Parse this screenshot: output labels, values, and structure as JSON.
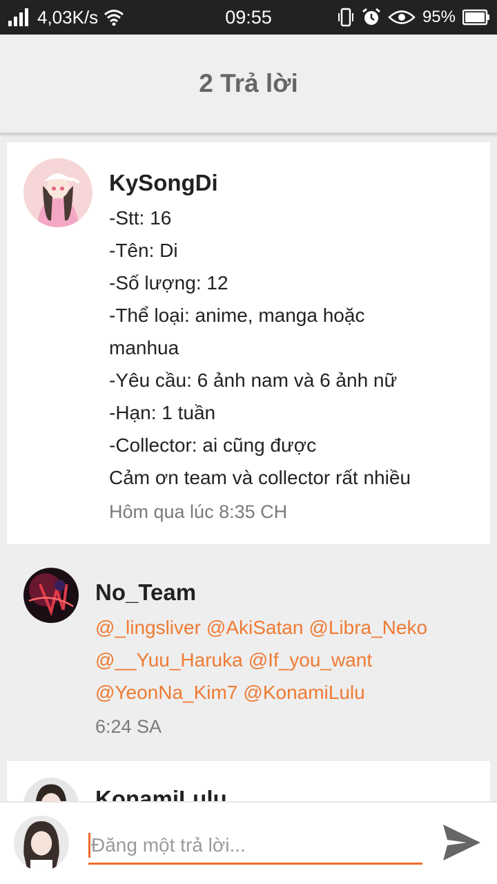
{
  "status_bar": {
    "network_speed": "4,03K/s",
    "time": "09:55",
    "battery": "95%"
  },
  "header": {
    "title": "2 Trả lời"
  },
  "comments": [
    {
      "username": "KySongDi",
      "lines": [
        "-Stt: 16",
        "-Tên: Di",
        "-Số lượng: 12",
        "-Thể loại: anime, manga hoặc",
        "manhua",
        "-Yêu cầu: 6 ảnh nam và 6 ảnh nữ",
        "-Hạn: 1 tuần",
        "-Collector: ai cũng được",
        "Cảm ơn team và collector rất nhiều"
      ],
      "timestamp": "Hôm qua lúc 8:35 CH"
    },
    {
      "username": "No_Team",
      "mentions": [
        "@_lingsliver",
        "@AkiSatan",
        "@Libra_Neko",
        "@__Yuu_Haruka",
        "@If_you_want",
        "@YeonNa_Kim7",
        "@KonamiLulu"
      ],
      "timestamp": "6:24 SA"
    },
    {
      "username": "KonamiLulu"
    }
  ],
  "composer": {
    "placeholder": "Đăng một trả lời..."
  },
  "colors": {
    "accent": "#f06a2c",
    "mention": "#f07a33",
    "status_bar": "#222222",
    "header_bg": "#efefef"
  },
  "icons": {
    "signal": "signal-icon",
    "wifi": "wifi-icon",
    "vibrate": "vibrate-icon",
    "alarm": "alarm-icon",
    "eye": "eye-icon",
    "battery": "battery-icon",
    "send": "send-icon"
  }
}
